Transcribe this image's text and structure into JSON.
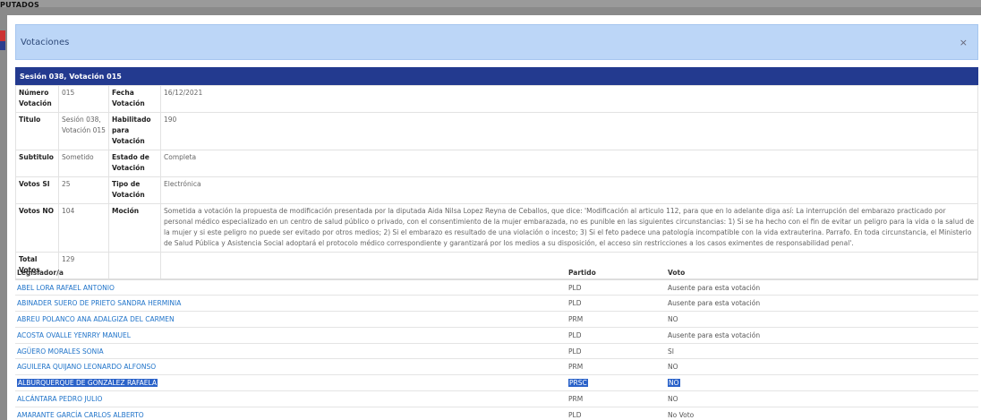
{
  "background": {
    "label": "PUTADOS"
  },
  "modal": {
    "title": "Votaciones",
    "close": "×"
  },
  "session": {
    "heading": "Sesión 038, Votación 015",
    "rows": [
      {
        "l1": "Número Votación",
        "v1": "015",
        "l2": "Fecha Votación",
        "v2": "16/12/2021"
      },
      {
        "l1": "Titulo",
        "v1": "Sesión 038, Votación 015",
        "l2": "Habilitado para Votación",
        "v2": "190"
      },
      {
        "l1": "Subtitulo",
        "v1": "Sometido",
        "l2": "Estado de Votación",
        "v2": "Completa"
      },
      {
        "l1": "Votos SI",
        "v1": "25",
        "l2": "Tipo de Votación",
        "v2": "Electrónica"
      },
      {
        "l1": "Votos NO",
        "v1": "104",
        "l2": "Moción",
        "v2": "Sometida a votación la propuesta de modificación presentada por la diputada Aida Nilsa Lopez Reyna de Ceballos, que dice: 'Modificación al articulo 112, para que en lo adelante diga así: La interrupción del embarazo practicado por personal médico especializado en un centro de salud público o privado, con el consentimiento de la mujer embarazada, no es punible en las siguientes circunstancias: 1) Si se ha hecho con el fin de evitar un peligro para la vida o la salud de la mujer y si este peligro no puede ser evitado por otros medios; 2) Si el embarazo es resultado de una violación o incesto; 3) Si el feto padece una patología incompatible con la vida extrauterina. Parrafo. En toda circunstancia, el Ministerio de Salud Pública y Asistencia Social adoptará el protocolo médico correspondiente y garantizará por los medios a su disposición, el acceso sin restricciones a los casos eximentes de responsabilidad penal'."
      },
      {
        "l1": "Total Votos",
        "v1": "129",
        "l2": "",
        "v2": ""
      }
    ]
  },
  "legislators": {
    "headers": {
      "name": "Legislador/a",
      "party": "Partido",
      "vote": "Voto"
    },
    "rows": [
      {
        "name": "ABEL LORA RAFAEL ANTONIO",
        "party": "PLD",
        "vote": "Ausente para esta votación"
      },
      {
        "name": "ABINADER SUERO DE PRIETO SANDRA HERMINIA",
        "party": "PLD",
        "vote": "Ausente para esta votación"
      },
      {
        "name": "ABREU POLANCO ANA ADALGIZA DEL CARMEN",
        "party": "PRM",
        "vote": "NO"
      },
      {
        "name": "ACOSTA OVALLE YENRRY MANUEL",
        "party": "PLD",
        "vote": "Ausente para esta votación"
      },
      {
        "name": "AGÜERO MORALES SONIA",
        "party": "PLD",
        "vote": "SI"
      },
      {
        "name": "AGUILERA QUIJANO LEONARDO ALFONSO",
        "party": "PRM",
        "vote": "NO"
      },
      {
        "name": "ALBURQUERQUE DE GONZÁLEZ RAFAELA",
        "party": "PRSC",
        "vote": "NO"
      },
      {
        "name": "ALCÁNTARA PEDRO JULIO",
        "party": "PRM",
        "vote": "NO"
      },
      {
        "name": "AMARANTE GARCÍA CARLOS ALBERTO",
        "party": "PLD",
        "vote": "No Voto"
      }
    ]
  }
}
